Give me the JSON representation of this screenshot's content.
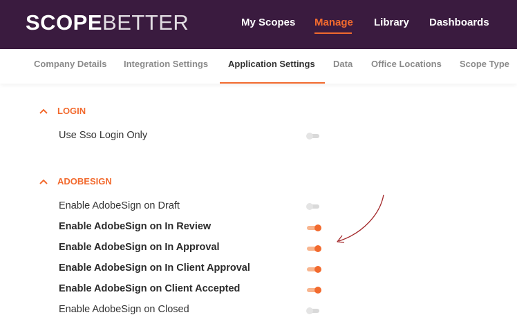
{
  "brand": {
    "part1": "SCOPE",
    "part2": "BETTER",
    "accent": "#f26a2e",
    "bar_color": "#3a1b3f"
  },
  "nav": {
    "items": [
      {
        "label": "My Scopes"
      },
      {
        "label": "Manage"
      },
      {
        "label": "Library"
      },
      {
        "label": "Dashboards"
      }
    ],
    "active": "Manage"
  },
  "subnav": {
    "items": [
      {
        "label": "Company Details"
      },
      {
        "label": "Integration Settings"
      },
      {
        "label": "Application Settings"
      },
      {
        "label": "Data"
      },
      {
        "label": "Office Locations"
      },
      {
        "label": "Scope Type"
      }
    ],
    "active": "Application Settings"
  },
  "sections": [
    {
      "title": "LOGIN",
      "icon": "chevron-up-icon",
      "settings": [
        {
          "label": "Use Sso Login Only",
          "enabled": false
        }
      ]
    },
    {
      "title": "ADOBESIGN",
      "icon": "chevron-up-icon",
      "settings": [
        {
          "label": "Enable AdobeSign on Draft",
          "enabled": false
        },
        {
          "label": "Enable AdobeSign on In Review",
          "enabled": true
        },
        {
          "label": "Enable AdobeSign on In Approval",
          "enabled": true
        },
        {
          "label": "Enable AdobeSign on In Client Approval",
          "enabled": true
        },
        {
          "label": "Enable AdobeSign on Client Accepted",
          "enabled": true
        },
        {
          "label": "Enable AdobeSign on Closed",
          "enabled": false
        }
      ]
    }
  ],
  "annotation": {
    "icon": "curved-arrow-icon",
    "color": "#a3282a"
  }
}
